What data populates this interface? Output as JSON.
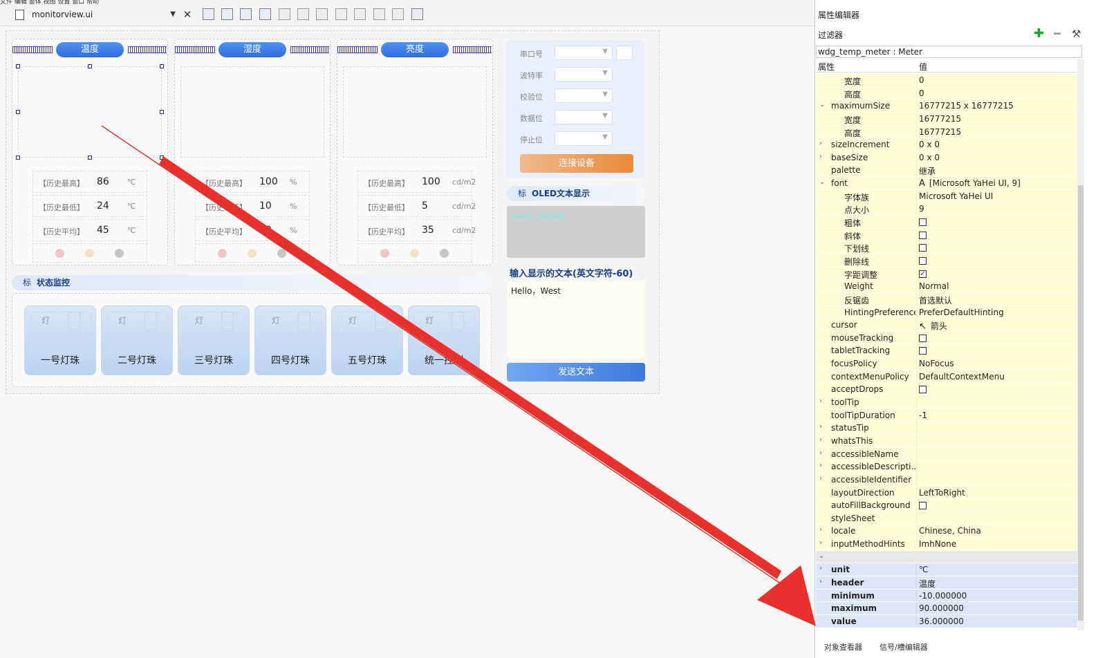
{
  "toolbar": {
    "menu_text": "文件  编辑  窗体  视图  设置  窗口  帮助",
    "file_name": "monitorview.ui",
    "close_glyph": "✕"
  },
  "meters": [
    {
      "header": "温度",
      "rows": [
        {
          "label": "【历史最高】",
          "value": "86",
          "unit": "℃"
        },
        {
          "label": "【历史最低】",
          "value": "24",
          "unit": "℃"
        },
        {
          "label": "【历史平均】",
          "value": "45",
          "unit": "℃"
        }
      ]
    },
    {
      "header": "湿度",
      "rows": [
        {
          "label": "【历史最高】",
          "value": "100",
          "unit": "%"
        },
        {
          "label": "【历史最低】",
          "value": "10",
          "unit": "%"
        },
        {
          "label": "【历史平均】",
          "value": "20",
          "unit": "%"
        }
      ]
    },
    {
      "header": "亮度",
      "rows": [
        {
          "label": "【历史最高】",
          "value": "100",
          "unit": "cd/m2"
        },
        {
          "label": "【历史最低】",
          "value": "5",
          "unit": "cd/m2"
        },
        {
          "label": "【历史平均】",
          "value": "35",
          "unit": "cd/m2"
        }
      ]
    }
  ],
  "status_colors": {
    "red": "#f6c4c4",
    "orange": "#fbe1c4",
    "grey": "#c6c6c6"
  },
  "serial": {
    "port_label": "串口号",
    "baud_label": "波特率",
    "parity_label": "校验位",
    "data_label": "数据位",
    "stop_label": "停止位",
    "connect_label": "连接设备"
  },
  "oled": {
    "header": "OLED文本显示",
    "header_icon": "标",
    "display_text": "Hello，Beijing",
    "input_label": "输入显示的文本(英文字符-60)",
    "input_value": "Hello，West",
    "send_label": "发送文本"
  },
  "status_panel": {
    "header_icon": "标",
    "header": "状态监控",
    "lamp_icon": "灯",
    "lamps": [
      "一号灯珠",
      "二号灯珠",
      "三号灯珠",
      "四号灯珠",
      "五号灯珠",
      "统一控制"
    ]
  },
  "property_editor": {
    "title": "属性编辑器",
    "filter_label": "过滤器",
    "object": "wdg_temp_meter : Meter",
    "col_property": "属性",
    "col_value": "值",
    "rows": [
      {
        "name": "宽度",
        "value": "0",
        "level": 2
      },
      {
        "name": "高度",
        "value": "0",
        "level": 2
      },
      {
        "name": "maximumSize",
        "value": "16777215 x 16777215",
        "level": 1,
        "expand": "open"
      },
      {
        "name": "宽度",
        "value": "16777215",
        "level": 2
      },
      {
        "name": "高度",
        "value": "16777215",
        "level": 2
      },
      {
        "name": "sizeIncrement",
        "value": "0 x 0",
        "level": 1,
        "expand": "closed"
      },
      {
        "name": "baseSize",
        "value": "0 x 0",
        "level": 1,
        "expand": "closed"
      },
      {
        "name": "palette",
        "value": "继承",
        "level": 1
      },
      {
        "name": "font",
        "value": "[Microsoft YaHei UI, 9]",
        "level": 1,
        "expand": "open",
        "icon": "A"
      },
      {
        "name": "字体族",
        "value": "Microsoft YaHei UI",
        "level": 2
      },
      {
        "name": "点大小",
        "value": "9",
        "level": 2
      },
      {
        "name": "粗体",
        "check": false,
        "level": 2
      },
      {
        "name": "斜体",
        "check": false,
        "level": 2
      },
      {
        "name": "下划线",
        "check": false,
        "level": 2
      },
      {
        "name": "删除线",
        "check": false,
        "level": 2
      },
      {
        "name": "字距调整",
        "check": true,
        "level": 2
      },
      {
        "name": "Weight",
        "value": "Normal",
        "level": 2
      },
      {
        "name": "反锯齿",
        "value": "首选默认",
        "level": 2
      },
      {
        "name": "HintingPreference",
        "value": "PreferDefaultHinting",
        "level": 2
      },
      {
        "name": "cursor",
        "value": "箭头",
        "level": 1,
        "icon": "↖"
      },
      {
        "name": "mouseTracking",
        "check": false,
        "level": 1
      },
      {
        "name": "tabletTracking",
        "check": false,
        "level": 1
      },
      {
        "name": "focusPolicy",
        "value": "NoFocus",
        "level": 1
      },
      {
        "name": "contextMenuPolicy",
        "value": "DefaultContextMenu",
        "level": 1
      },
      {
        "name": "acceptDrops",
        "check": false,
        "level": 1
      },
      {
        "name": "toolTip",
        "value": "",
        "level": 1,
        "expand": "closed"
      },
      {
        "name": "toolTipDuration",
        "value": "-1",
        "level": 1
      },
      {
        "name": "statusTip",
        "value": "",
        "level": 1,
        "expand": "closed"
      },
      {
        "name": "whatsThis",
        "value": "",
        "level": 1,
        "expand": "closed"
      },
      {
        "name": "accessibleName",
        "value": "",
        "level": 1,
        "expand": "closed"
      },
      {
        "name": "accessibleDescripti...",
        "value": "",
        "level": 1,
        "expand": "closed"
      },
      {
        "name": "accessibleIdentifier",
        "value": "",
        "level": 1,
        "expand": "closed"
      },
      {
        "name": "layoutDirection",
        "value": "LeftToRight",
        "level": 1
      },
      {
        "name": "autoFillBackground",
        "check": false,
        "level": 1
      },
      {
        "name": "styleSheet",
        "value": "",
        "level": 1
      },
      {
        "name": "locale",
        "value": "Chinese, China",
        "level": 1,
        "expand": "closed"
      },
      {
        "name": "inputMethodHints",
        "value": "ImhNone",
        "level": 1,
        "expand": "closed"
      },
      {
        "name": "",
        "value": "",
        "level": 0,
        "expand": "open",
        "group": true
      },
      {
        "name": "unit",
        "value": "℃",
        "level": 1,
        "expand": "closed",
        "dyn": true
      },
      {
        "name": "header",
        "value": "温度",
        "level": 1,
        "expand": "closed",
        "dyn": true
      },
      {
        "name": "minimum",
        "value": "-10.000000",
        "level": 1,
        "dyn": true
      },
      {
        "name": "maximum",
        "value": "90.000000",
        "level": 1,
        "dyn": true
      },
      {
        "name": "value",
        "value": "36.000000",
        "level": 1,
        "dyn": true
      }
    ],
    "bottom_tabs": [
      "对象查看器",
      "信号/槽编辑器"
    ]
  },
  "colors": {
    "annotation_arrow": "#e8302d",
    "accent_blue": "#2e6ee0",
    "property_row": "#fffcd8",
    "dynamic_row": "#dde6f9"
  }
}
